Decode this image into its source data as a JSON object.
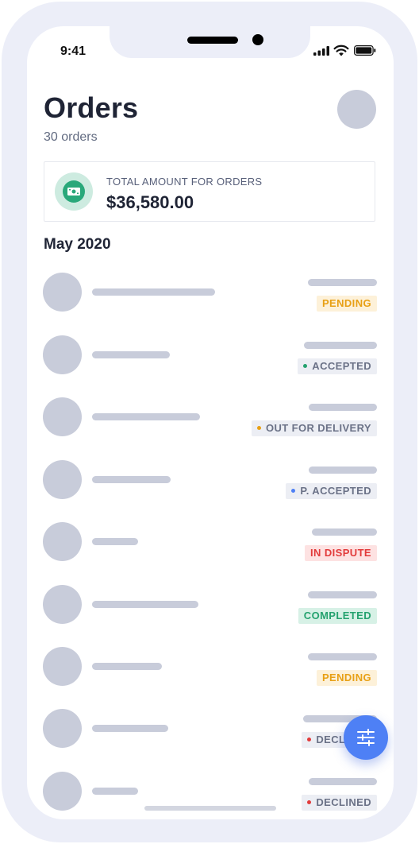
{
  "status_bar": {
    "time": "9:41"
  },
  "header": {
    "title": "Orders",
    "count_text": "30 orders"
  },
  "summary": {
    "label": "TOTAL AMOUNT FOR ORDERS",
    "amount": "$36,580.00",
    "icon": "cash-icon"
  },
  "section": {
    "month": "May 2020"
  },
  "orders": [
    {
      "status": "PENDING",
      "status_color": "#e8a015"
    },
    {
      "status": "ACCEPTED",
      "status_color": "#25a26f"
    },
    {
      "status": "OUT FOR DELIVERY",
      "status_color": "#e8a015"
    },
    {
      "status": "P. ACCEPTED",
      "status_color": "#4e80f5"
    },
    {
      "status": "IN DISPUTE",
      "status_color": "#e23b3b"
    },
    {
      "status": "COMPLETED",
      "status_color": "#25a26f"
    },
    {
      "status": "PENDING",
      "status_color": "#e8a015"
    },
    {
      "status": "DECLINED",
      "status_color": "#e23b3b"
    },
    {
      "status": "DECLINED",
      "status_color": "#e23b3b"
    }
  ],
  "fab": {
    "icon": "filter-sliders-icon"
  },
  "colors": {
    "accent": "#4e80f5",
    "placeholder": "#c8ccda"
  }
}
